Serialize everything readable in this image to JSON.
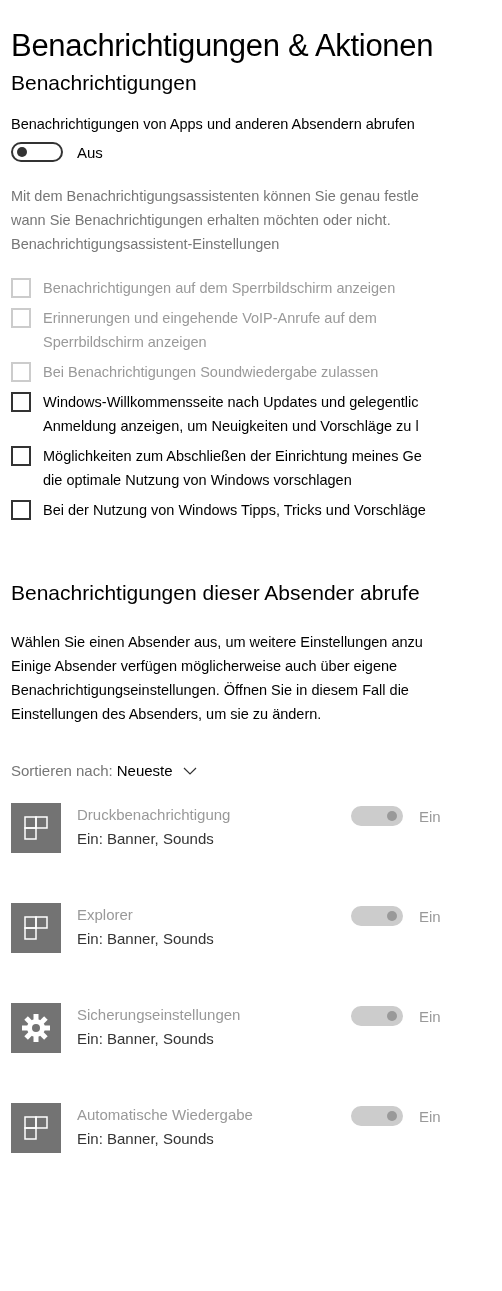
{
  "title": "Benachrichtigungen & Aktionen",
  "section_title": "Benachrichtigungen",
  "main_toggle": {
    "label": "Benachrichtigungen von Apps und anderen Absendern abrufen",
    "on": false,
    "state_text": "Aus"
  },
  "assistant_text": "Mit dem Benachrichtigungsassistenten können Sie genau festle\nwann Sie Benachrichtigungen erhalten möchten oder nicht.",
  "assistant_link": "Benachrichtigungsassistent-Einstellungen",
  "checkboxes": [
    {
      "label": "Benachrichtigungen auf dem Sperrbildschirm anzeigen",
      "checked": false,
      "disabled": true
    },
    {
      "label": "Erinnerungen und eingehende VoIP-Anrufe auf dem\nSperrbildschirm anzeigen",
      "checked": false,
      "disabled": true
    },
    {
      "label": "Bei Benachrichtigungen Soundwiedergabe zulassen",
      "checked": false,
      "disabled": true
    },
    {
      "label": "Windows-Willkommensseite nach Updates und gelegentlic\nAnmeldung anzeigen, um Neuigkeiten und Vorschläge zu l",
      "checked": false,
      "disabled": false
    },
    {
      "label": "Möglichkeiten zum Abschließen der Einrichtung meines Ge\ndie optimale Nutzung von Windows vorschlagen",
      "checked": false,
      "disabled": false
    },
    {
      "label": "Bei der Nutzung von Windows Tipps, Tricks und Vorschläge",
      "checked": false,
      "disabled": false
    }
  ],
  "senders_title": "Benachrichtigungen dieser Absender abrufe",
  "senders_text": "Wählen Sie einen Absender aus, um weitere Einstellungen anzu\nEinige Absender verfügen möglicherweise auch über eigene\nBenachrichtigungseinstellungen. Öffnen Sie in diesem Fall die\nEinstellungen des Absenders, um sie zu ändern.",
  "sort": {
    "label": "Sortieren nach:",
    "value": "Neueste"
  },
  "senders": [
    {
      "name": "Druckbenachrichtigung",
      "detail": "Ein: Banner, Sounds",
      "kind": "tiles",
      "on": true,
      "disabled": true,
      "state_text": "Ein"
    },
    {
      "name": "Explorer",
      "detail": "Ein: Banner, Sounds",
      "kind": "tiles",
      "on": true,
      "disabled": true,
      "state_text": "Ein"
    },
    {
      "name": "Sicherungseinstellungen",
      "detail": "Ein: Banner, Sounds",
      "kind": "gear",
      "on": true,
      "disabled": true,
      "state_text": "Ein"
    },
    {
      "name": "Automatische Wiedergabe",
      "detail": "Ein: Banner, Sounds",
      "kind": "tiles",
      "on": true,
      "disabled": true,
      "state_text": "Ein"
    }
  ]
}
